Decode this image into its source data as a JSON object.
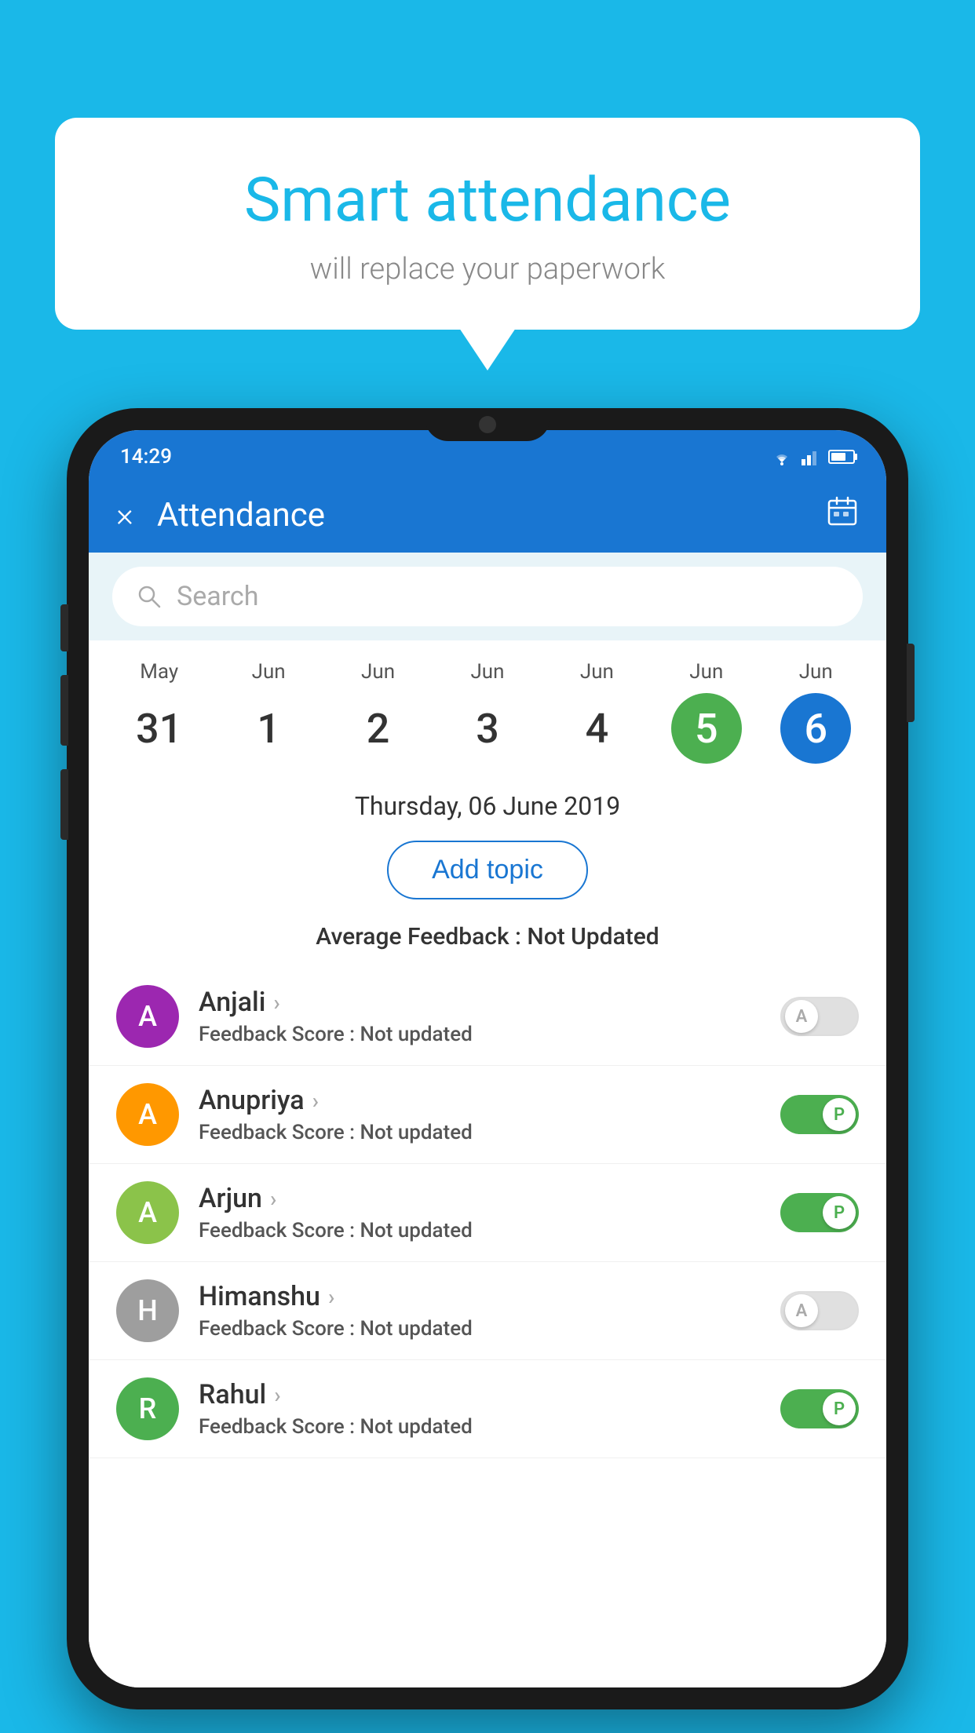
{
  "background_color": "#1ab8e8",
  "bubble": {
    "title": "Smart attendance",
    "subtitle": "will replace your paperwork"
  },
  "status_bar": {
    "time": "14:29",
    "wifi": "wifi-icon",
    "signal": "signal-icon",
    "battery": "battery-icon"
  },
  "app_bar": {
    "title": "Attendance",
    "close_label": "×",
    "calendar_label": "📅"
  },
  "search": {
    "placeholder": "Search"
  },
  "calendar": {
    "days": [
      {
        "month": "May",
        "date": "31",
        "state": "normal"
      },
      {
        "month": "Jun",
        "date": "1",
        "state": "normal"
      },
      {
        "month": "Jun",
        "date": "2",
        "state": "normal"
      },
      {
        "month": "Jun",
        "date": "3",
        "state": "normal"
      },
      {
        "month": "Jun",
        "date": "4",
        "state": "normal"
      },
      {
        "month": "Jun",
        "date": "5",
        "state": "today"
      },
      {
        "month": "Jun",
        "date": "6",
        "state": "selected"
      }
    ]
  },
  "date_header": "Thursday, 06 June 2019",
  "add_topic_label": "Add topic",
  "avg_feedback_label": "Average Feedback : ",
  "avg_feedback_value": "Not Updated",
  "students": [
    {
      "name": "Anjali",
      "initial": "A",
      "avatar_color": "#9c27b0",
      "feedback_label": "Feedback Score : ",
      "feedback_value": "Not updated",
      "toggle_state": "off",
      "toggle_letter": "A"
    },
    {
      "name": "Anupriya",
      "initial": "A",
      "avatar_color": "#ff9800",
      "feedback_label": "Feedback Score : ",
      "feedback_value": "Not updated",
      "toggle_state": "on",
      "toggle_letter": "P"
    },
    {
      "name": "Arjun",
      "initial": "A",
      "avatar_color": "#8bc34a",
      "feedback_label": "Feedback Score : ",
      "feedback_value": "Not updated",
      "toggle_state": "on",
      "toggle_letter": "P"
    },
    {
      "name": "Himanshu",
      "initial": "H",
      "avatar_color": "#9e9e9e",
      "feedback_label": "Feedback Score : ",
      "feedback_value": "Not updated",
      "toggle_state": "off",
      "toggle_letter": "A"
    },
    {
      "name": "Rahul",
      "initial": "R",
      "avatar_color": "#4caf50",
      "feedback_label": "Feedback Score : ",
      "feedback_value": "Not updated",
      "toggle_state": "on",
      "toggle_letter": "P"
    }
  ]
}
